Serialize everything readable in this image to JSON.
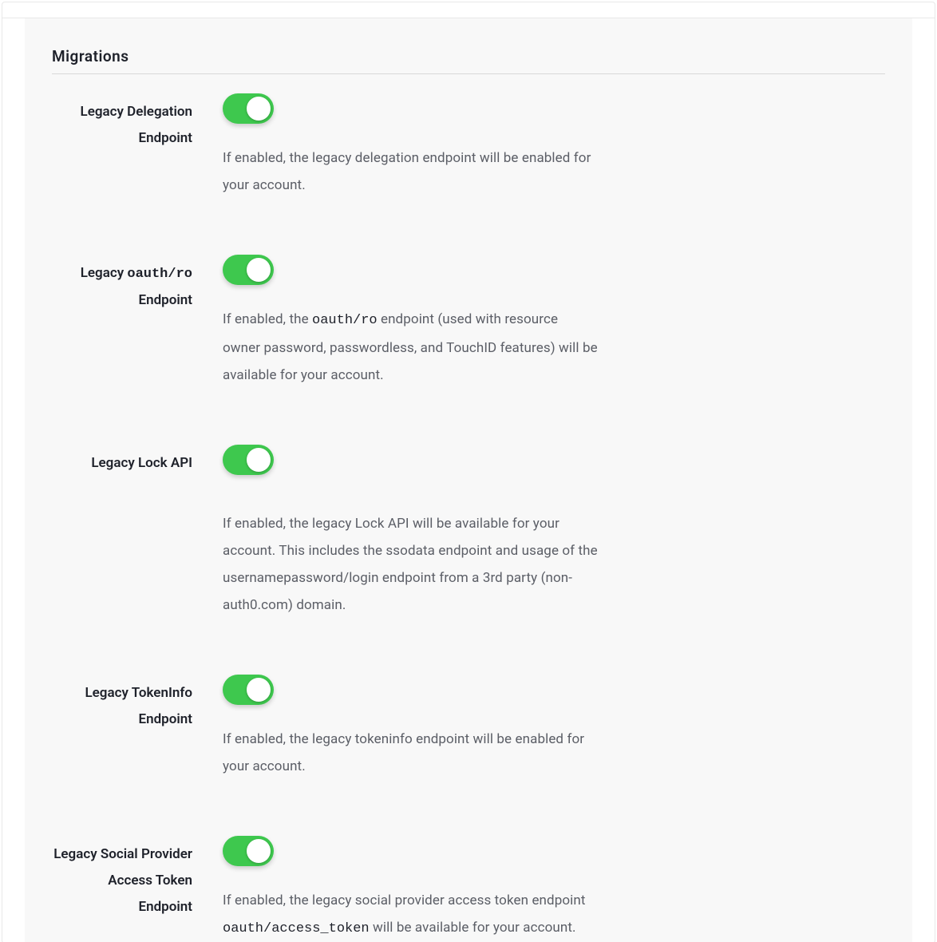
{
  "section_title": "Migrations",
  "settings": [
    {
      "id": "legacy-delegation-endpoint",
      "label": "Legacy Delegation Endpoint",
      "enabled": true,
      "desc_pre": "If enabled, the legacy delegation endpoint will be enabled for your account.",
      "code": "",
      "desc_post": ""
    },
    {
      "id": "legacy-oauth-ro-endpoint",
      "label_pre": "Legacy ",
      "label_code": "oauth/ro",
      "label_post": " Endpoint",
      "enabled": true,
      "desc_pre": "If enabled, the ",
      "code": "oauth/ro",
      "desc_post": " endpoint (used with resource owner password, passwordless, and TouchID features) will be available for your account."
    },
    {
      "id": "legacy-lock-api",
      "label": "Legacy Lock API",
      "enabled": true,
      "desc_pre": "If enabled, the legacy Lock API will be available for your account. This includes the ssodata endpoint and usage of the usernamepassword/login endpoint from a 3rd party (non-auth0.com) domain.",
      "code": "",
      "desc_post": ""
    },
    {
      "id": "legacy-tokeninfo-endpoint",
      "label": "Legacy TokenInfo Endpoint",
      "enabled": true,
      "desc_pre": "If enabled, the legacy tokeninfo endpoint will be enabled for your account.",
      "code": "",
      "desc_post": ""
    },
    {
      "id": "legacy-social-provider-access-token-endpoint",
      "label": "Legacy Social Provider Access Token Endpoint",
      "enabled": true,
      "desc_pre": "If enabled, the legacy social provider access token endpoint ",
      "code": "oauth/access_token",
      "desc_post": " will be available for your account."
    }
  ]
}
